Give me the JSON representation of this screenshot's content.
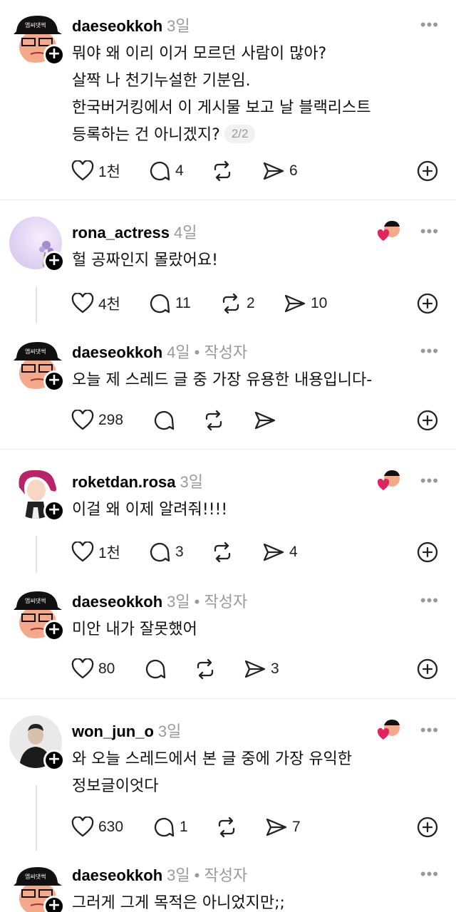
{
  "posts": [
    {
      "username": "daeseokkoh",
      "time": "3일",
      "author_tag": "",
      "lines": [
        "뭐야 왜 이리 이거 모르던 사람이 많아?",
        "살짝 나 천기누설한 기분임.",
        "한국버거킹에서 이 게시물 보고 날 블랙리스트",
        "등록하는 건 아니겠지?"
      ],
      "counter": "2/2",
      "likes": "1천",
      "replies": "4",
      "reposts": "",
      "shares": "6"
    },
    {
      "username": "rona_actress",
      "time": "4일",
      "author_tag": "",
      "lines": [
        "헐 공짜인지 몰랐어요!"
      ],
      "likes": "4천",
      "replies": "11",
      "reposts": "2",
      "shares": "10"
    },
    {
      "username": "daeseokkoh",
      "time": "4일",
      "author_tag": "• 작성자",
      "lines": [
        "오늘 제 스레드 글 중 가장 유용한 내용입니다-"
      ],
      "likes": "298",
      "replies": "",
      "reposts": "",
      "shares": ""
    },
    {
      "username": "roketdan.rosa",
      "time": "3일",
      "author_tag": "",
      "lines": [
        "이걸 왜 이제 알려줘!!!!"
      ],
      "likes": "1천",
      "replies": "3",
      "reposts": "",
      "shares": "4"
    },
    {
      "username": "daeseokkoh",
      "time": "3일",
      "author_tag": "• 작성자",
      "lines": [
        "미안 내가 잘못했어"
      ],
      "likes": "80",
      "replies": "",
      "reposts": "",
      "shares": "3"
    },
    {
      "username": "won_jun_o",
      "time": "3일",
      "author_tag": "",
      "lines": [
        "와 오늘 스레드에서 본 글 중에 가장 유익한",
        "정보글이엇다"
      ],
      "likes": "630",
      "replies": "1",
      "reposts": "",
      "shares": "7"
    },
    {
      "username": "daeseokkoh",
      "time": "3일",
      "author_tag": "• 작성자",
      "lines": [
        "그러게 그게 목적은 아니었지만;;"
      ]
    }
  ],
  "more_label": "•••",
  "plus_glyph": "+",
  "colors": {
    "meta_gray": "#9a9a9a",
    "liked_heart": "#e0245e"
  }
}
